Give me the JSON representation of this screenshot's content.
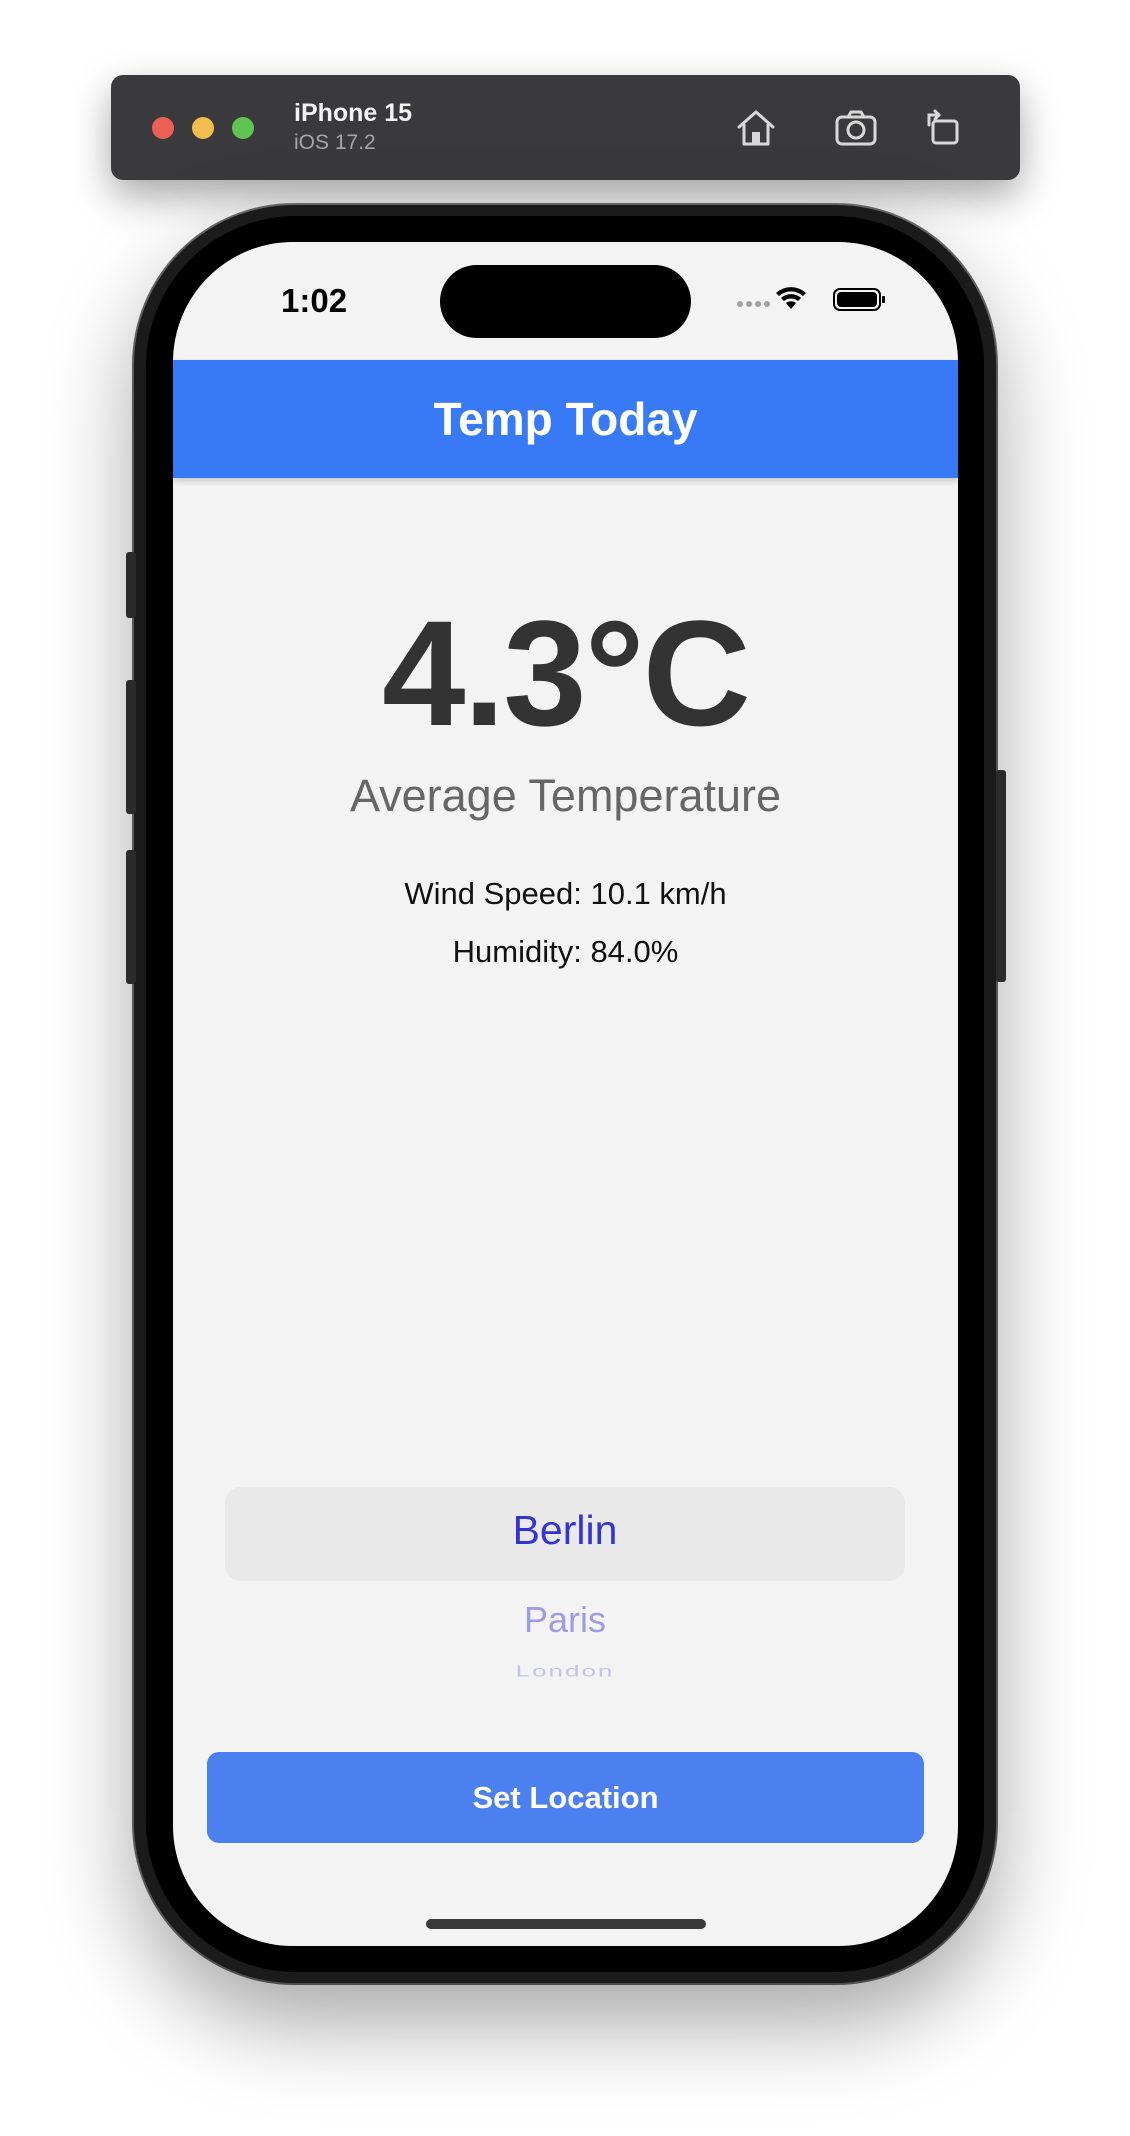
{
  "simulator": {
    "device_name": "iPhone 15",
    "os_version": "iOS 17.2",
    "buttons": [
      "home-icon",
      "screenshot-icon",
      "rotate-icon"
    ]
  },
  "status_bar": {
    "time": "1:02",
    "icons": [
      "cellular-dots-icon",
      "wifi-icon",
      "battery-icon"
    ]
  },
  "header": {
    "title": "Temp Today",
    "color": "#387af5"
  },
  "weather": {
    "temperature": "4.3°C",
    "caption": "Average Temperature",
    "wind_speed": "Wind Speed: 10.1 km/h",
    "humidity": "Humidity: 84.0%"
  },
  "picker": {
    "selected": "Berlin",
    "options": [
      "Berlin",
      "Paris",
      "London"
    ],
    "text_color": "#3434d3"
  },
  "actions": {
    "set_location_label": "Set Location",
    "button_color": "#4c80ee"
  }
}
